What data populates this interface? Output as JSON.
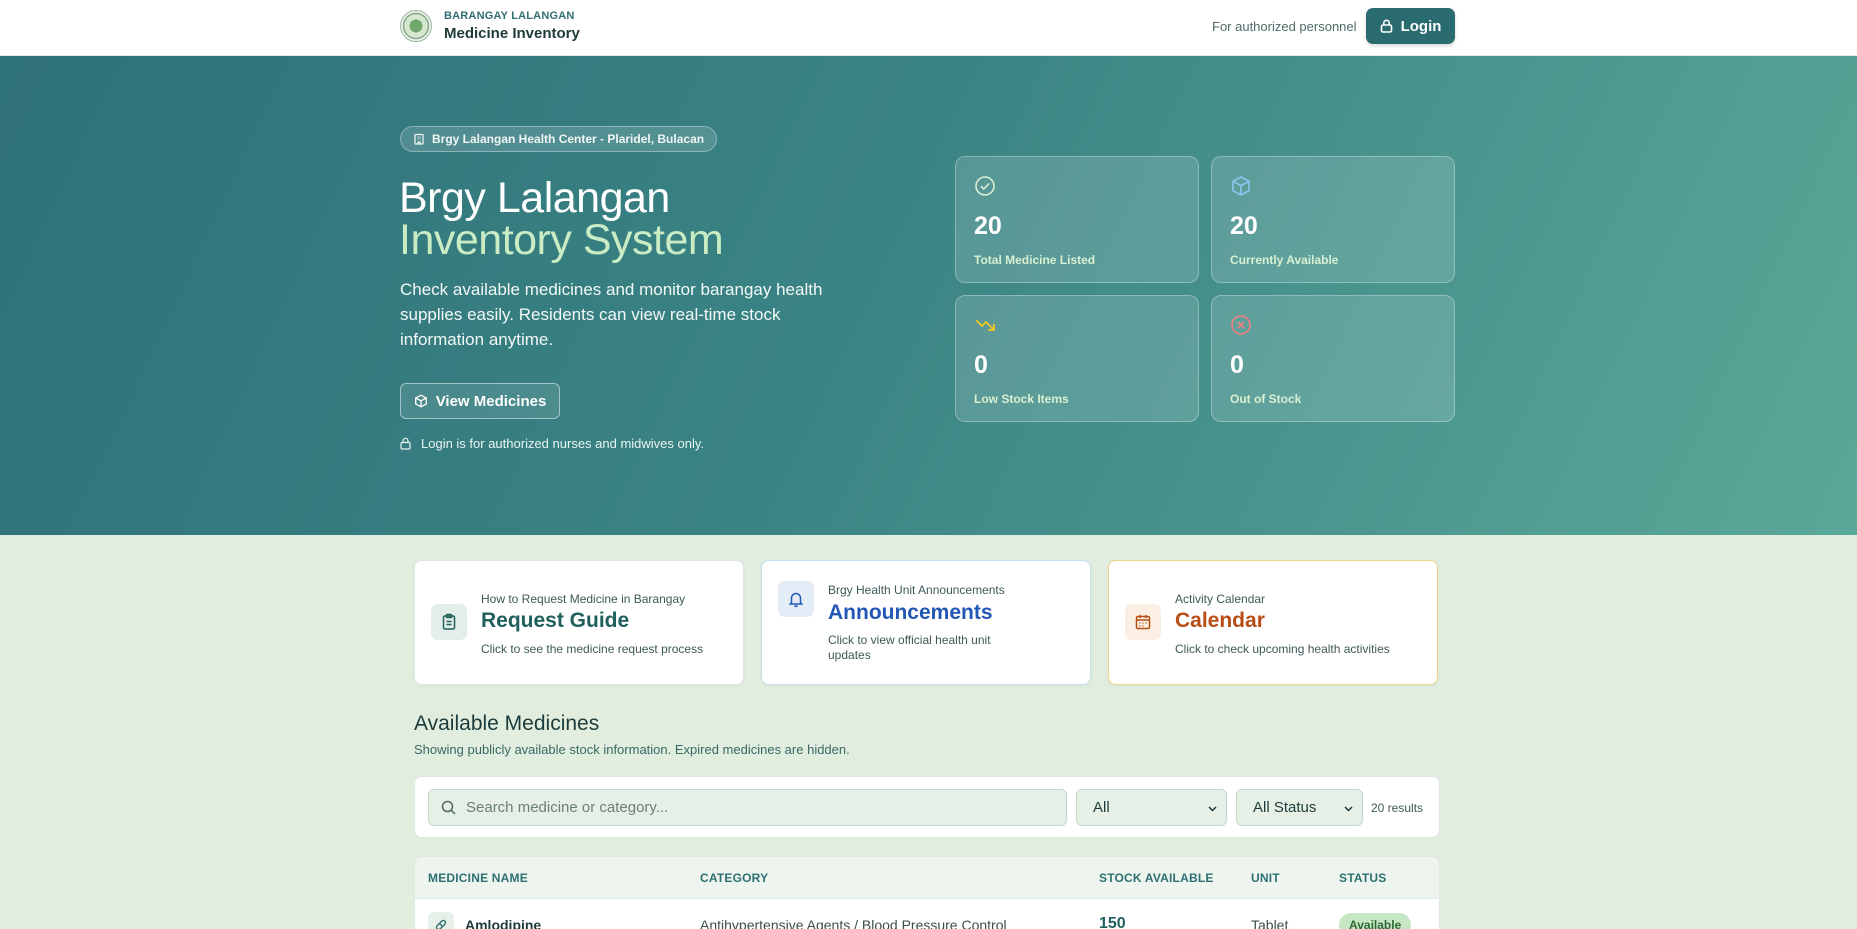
{
  "header": {
    "brand_sub": "BARANGAY LALANGAN",
    "brand_title": "Medicine Inventory",
    "auth_note": "For authorized personnel",
    "login_label": "Login"
  },
  "hero": {
    "location": "Brgy Lalangan Health Center - Plaridel, Bulacan",
    "title_line1": "Brgy Lalangan",
    "title_line2": "Inventory System",
    "description": "Check available medicines and monitor barangay health supplies easily. Residents can view real-time stock information anytime.",
    "view_button": "View Medicines",
    "login_note": "Login is for authorized nurses and midwives only."
  },
  "stats": [
    {
      "value": "20",
      "label": "Total Medicine Listed",
      "icon": "check-circle-icon",
      "icon_color": "#d8f0d2"
    },
    {
      "value": "20",
      "label": "Currently Available",
      "icon": "box-icon",
      "icon_color": "#8cc6f0"
    },
    {
      "value": "0",
      "label": "Low Stock Items",
      "icon": "trending-down-icon",
      "icon_color": "#f2c624"
    },
    {
      "value": "0",
      "label": "Out of Stock",
      "icon": "x-circle-icon",
      "icon_color": "#f08080"
    }
  ],
  "quick_cards": [
    {
      "subtitle": "How to Request Medicine in Barangay",
      "title": "Request Guide",
      "description": "Click to see the medicine request process",
      "accent": "#1f5f5c"
    },
    {
      "subtitle": "Brgy Health Unit Announcements",
      "title": "Announcements",
      "description": "Click to view official health unit updates",
      "accent": "#2357b5"
    },
    {
      "subtitle": "Activity Calendar",
      "title": "Calendar",
      "description": "Click to check upcoming health activities",
      "accent": "#b84d16"
    }
  ],
  "medicines": {
    "title": "Available Medicines",
    "description": "Showing publicly available stock information. Expired medicines are hidden.",
    "search_placeholder": "Search medicine or category...",
    "category_filter": "All",
    "status_filter": "All Status",
    "results": "20 results",
    "columns": [
      "MEDICINE NAME",
      "CATEGORY",
      "STOCK AVAILABLE",
      "UNIT",
      "STATUS"
    ],
    "rows": [
      {
        "name": "Amlodipine",
        "category": "Antihypertensive Agents / Blood Pressure Control",
        "stock": "150",
        "unit": "Tablet",
        "status": "Available"
      }
    ]
  }
}
